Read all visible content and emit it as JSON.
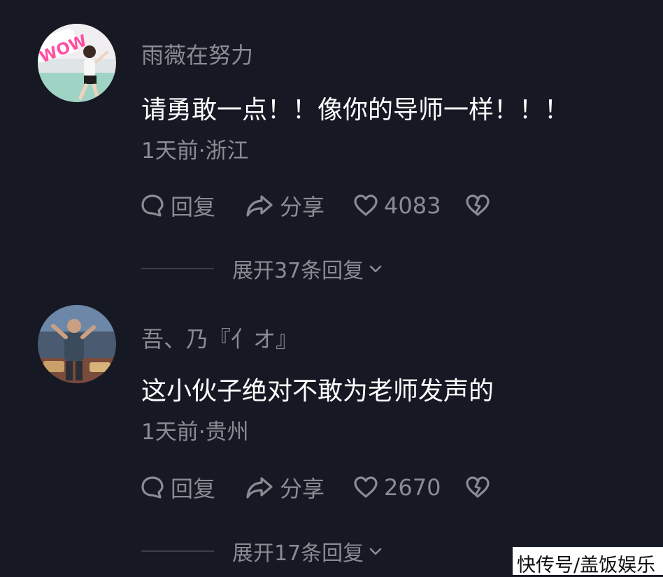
{
  "comments": [
    {
      "avatar_icon": "user-avatar-dancer-photo",
      "username": "雨薇在努力",
      "text": "请勇敢一点！！像你的导师一样！！！",
      "meta": "1天前·浙江",
      "reply_label": "回复",
      "share_label": "分享",
      "like_count": "4083",
      "expand_label": "展开37条回复"
    },
    {
      "avatar_icon": "user-avatar-man-photo",
      "username": "吾、乃『亻オ』",
      "text": "这小伙子绝对不敢为老师发声的",
      "meta": "1天前·贵州",
      "reply_label": "回复",
      "share_label": "分享",
      "like_count": "2670",
      "expand_label": "展开17条回复"
    }
  ],
  "watermark": "快传号/盖饭娱乐",
  "icons": {
    "reply": "speech-bubble-icon",
    "share": "share-arrow-icon",
    "like": "heart-icon",
    "dislike": "broken-heart-icon",
    "expand": "chevron-down-icon"
  },
  "colors": {
    "background": "#161823",
    "primary_text": "#ffffff",
    "secondary_text": "#8b8b93",
    "divider": "#3c3d47",
    "wow_text": "#ff4fa3"
  }
}
